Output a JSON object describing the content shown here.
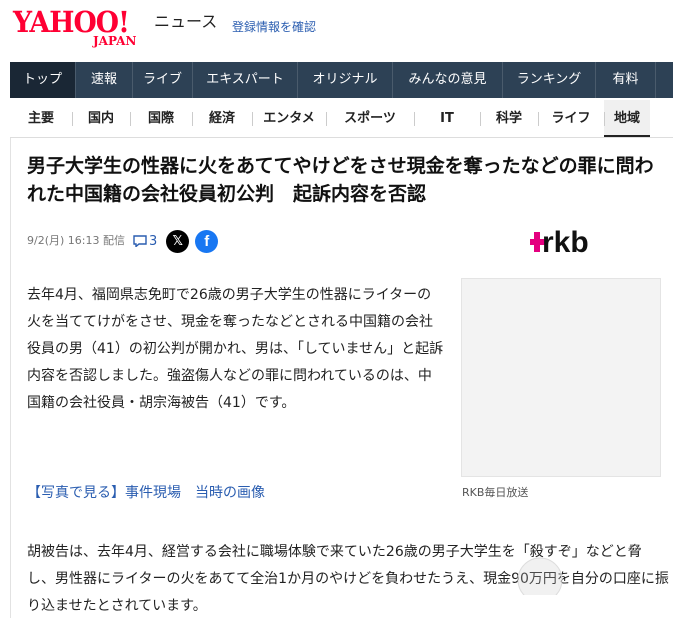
{
  "header": {
    "logo_main": "YAHOO!",
    "logo_sub": "JAPAN",
    "section": "ニュース",
    "register_link": "登録情報を確認"
  },
  "nav_primary": [
    {
      "label": "トップ",
      "active": true
    },
    {
      "label": "速報"
    },
    {
      "label": "ライブ"
    },
    {
      "label": "エキスパート"
    },
    {
      "label": "オリジナル"
    },
    {
      "label": "みんなの意見"
    },
    {
      "label": "ランキング"
    },
    {
      "label": "有料"
    }
  ],
  "nav_secondary": [
    {
      "label": "主要"
    },
    {
      "label": "国内"
    },
    {
      "label": "国際"
    },
    {
      "label": "経済"
    },
    {
      "label": "エンタメ"
    },
    {
      "label": "スポーツ"
    },
    {
      "label": "IT"
    },
    {
      "label": "科学"
    },
    {
      "label": "ライフ"
    },
    {
      "label": "地域",
      "active": true
    }
  ],
  "article": {
    "title": "男子大学生の性器に火をあててやけどをさせ現金を奪ったなどの罪に問われた中国籍の会社役員初公判　起訴内容を否認",
    "date": "9/2(月) 16:13 配信",
    "comment_count": "3",
    "publisher_logo": "rkb",
    "lead": "去年4月、福岡県志免町で26歳の男子大学生の性器にライターの火を当ててけがをさせ、現金を奪ったなどとされる中国籍の会社役員の男（41）の初公判が開かれ、男は、「していません」と起訴内容を否認しました。強盗傷人などの罪に問われているのは、中国籍の会社役員・胡宗海被告（41）です。",
    "photo_credit": "RKB毎日放送",
    "photo_links": [
      "【写真で見る】事件現場",
      "当時の画像"
    ],
    "body": "胡被告は、去年4月、経営する会社に職場体験で来ていた26歳の男子大学生を「殺すぞ」などと脅し、男性器にライターの火をあてて全治1か月のやけどを負わせたうえ、現金90万円を自分の口座に振り込ませたとされています。"
  },
  "colors": {
    "brand_red": "#ff0033",
    "nav_dark": "#2d4155",
    "link_blue": "#2a5db0",
    "rkb_magenta": "#e4007f",
    "facebook_blue": "#1877f2"
  }
}
